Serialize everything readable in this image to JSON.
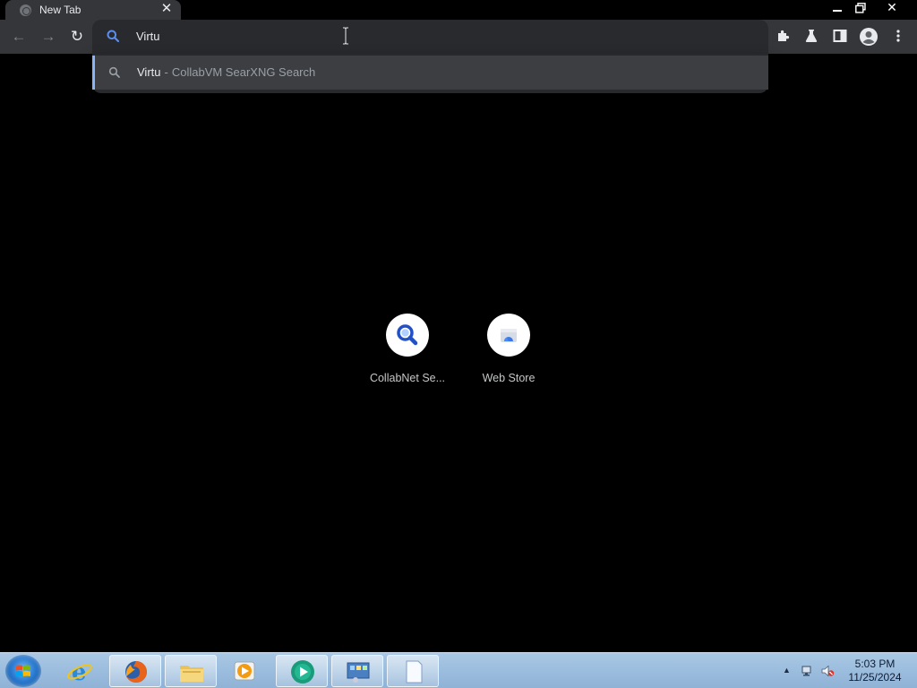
{
  "tab": {
    "title": "New Tab",
    "close_glyph": "✕"
  },
  "window_controls": {
    "minimize": "—",
    "restore": "❐",
    "close": "✕"
  },
  "toolbar": {
    "back_glyph": "←",
    "forward_glyph": "→",
    "reload_glyph": "↻",
    "omnibox_value": "Virtu",
    "icons": [
      "extensions-icon",
      "labs-flask-icon",
      "side-panel-icon",
      "profile-avatar-icon",
      "menu-kebab-icon"
    ]
  },
  "suggestion": {
    "query": "Virtu",
    "separator": "-",
    "description": "CollabVM SearXNG Search"
  },
  "shortcuts": [
    {
      "label": "CollabNet Se...",
      "icon": "magnifier-icon"
    },
    {
      "label": "Web Store",
      "icon": "web-store-icon"
    }
  ],
  "taskbar": {
    "apps": [
      "internet-explorer",
      "firefox",
      "file-explorer",
      "media-player",
      "media-center",
      "control-panel",
      "blank-document"
    ],
    "clock_time": "5:03 PM",
    "clock_date": "11/25/2024",
    "tray_arrow": "▲"
  },
  "colors": {
    "accent": "#8ab4f8",
    "search_icon_blue": "#1a73e8",
    "toolbar_bg": "#35363a"
  }
}
